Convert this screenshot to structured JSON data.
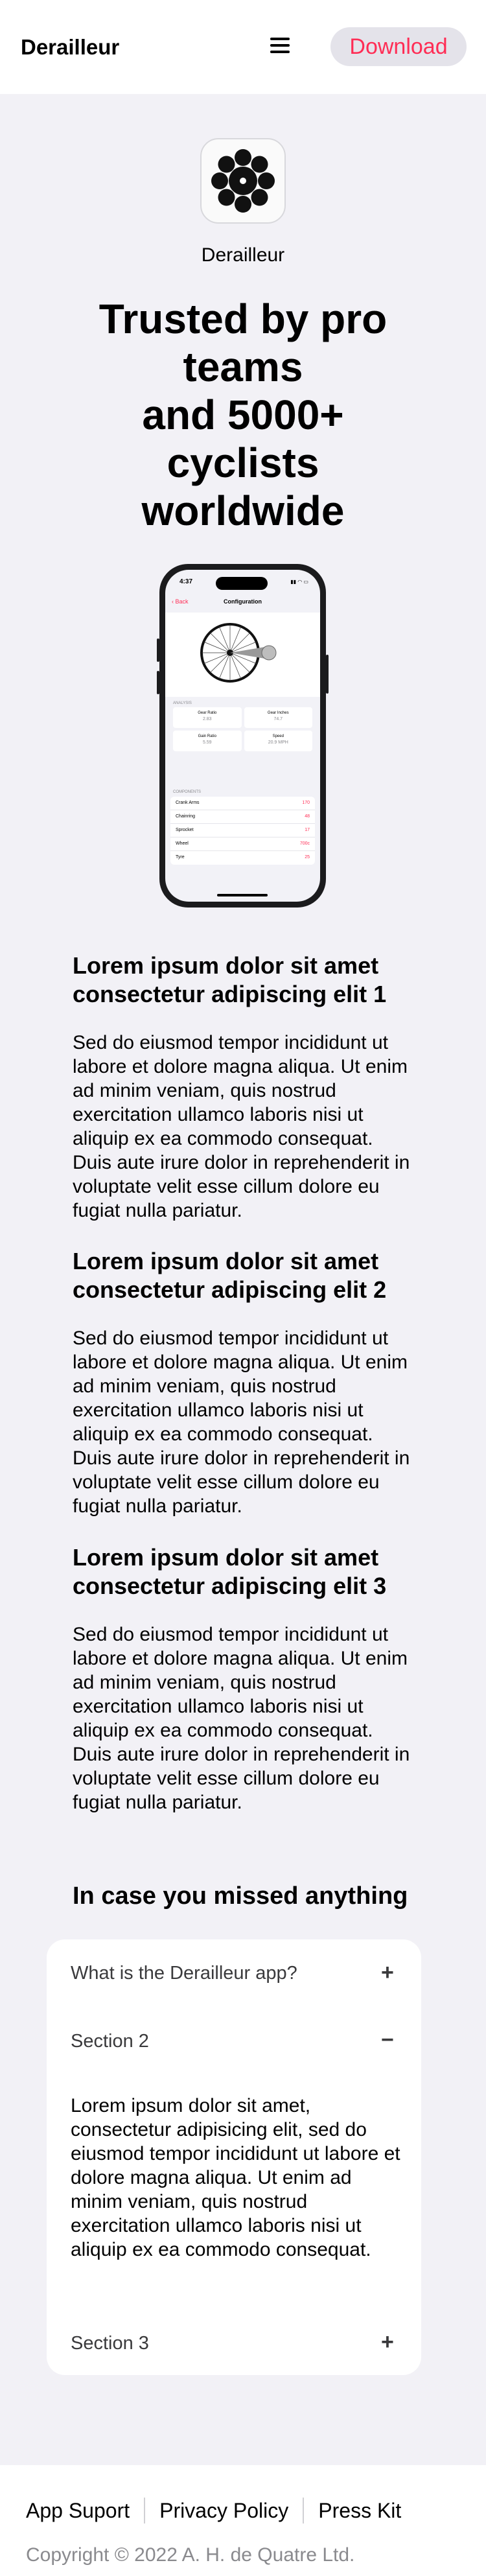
{
  "header": {
    "brand": "Derailleur",
    "menu_icon": "hamburger-menu-icon",
    "download_label": "Download"
  },
  "hero": {
    "app_icon": "derailleur-logo-icon",
    "app_name": "Derailleur",
    "headline_lines": [
      "Trusted by pro",
      "teams",
      "and 5000+",
      "cyclists",
      "worldwide"
    ]
  },
  "phone_mockup": {
    "time": "4:37",
    "back_label": "Back",
    "screen_title": "Configuration",
    "analysis_label": "ANALYSIS",
    "stats": [
      {
        "label": "Gear Ratio",
        "value": "2.83"
      },
      {
        "label": "Gear Inches",
        "value": "74.7"
      },
      {
        "label": "Gain Ratio",
        "value": "5.59"
      },
      {
        "label": "Speed",
        "value": "20.9 MPH"
      }
    ],
    "components_label": "COMPONENTS",
    "components": [
      {
        "label": "Crank Arms",
        "value": "170"
      },
      {
        "label": "Chainring",
        "value": "48"
      },
      {
        "label": "Sprocket",
        "value": "17"
      },
      {
        "label": "Wheel",
        "value": "700c"
      },
      {
        "label": "Tyre",
        "value": "25"
      }
    ]
  },
  "features": [
    {
      "title": "Lorem ipsum dolor sit amet consectetur adipiscing elit 1",
      "body": "Sed do eiusmod tempor incididunt ut labore et dolore magna aliqua. Ut enim ad minim veniam, quis nostrud exercitation ullamco laboris nisi ut aliquip ex ea commodo consequat. Duis aute irure dolor in reprehenderit in voluptate velit esse cillum dolore eu fugiat nulla pariatur."
    },
    {
      "title": "Lorem ipsum dolor sit amet consectetur adipiscing elit 2",
      "body": "Sed do eiusmod tempor incididunt ut labore et dolore magna aliqua. Ut enim ad minim veniam, quis nostrud exercitation ullamco laboris nisi ut aliquip ex ea commodo consequat. Duis aute irure dolor in reprehenderit in voluptate velit esse cillum dolore eu fugiat nulla pariatur."
    },
    {
      "title": "Lorem ipsum dolor sit amet consectetur adipiscing elit 3",
      "body": "Sed do eiusmod tempor incididunt ut labore et dolore magna aliqua. Ut enim ad minim veniam, quis nostrud exercitation ullamco laboris nisi ut aliquip ex ea commodo consequat. Duis aute irure dolor in reprehenderit in voluptate velit esse cillum dolore eu fugiat nulla pariatur."
    }
  ],
  "faq": {
    "heading": "In case you missed anything",
    "items": [
      {
        "question": "What is the Derailleur app?",
        "sign": "+",
        "expanded": false
      },
      {
        "question": "Section 2",
        "sign": "−",
        "expanded": true,
        "answer": "Lorem ipsum dolor sit amet, consectetur adipisicing elit, sed do eiusmod tempor incididunt ut labore et dolore magna aliqua. Ut enim ad minim veniam, quis nostrud exercitation ullamco laboris nisi ut aliquip ex ea commodo consequat."
      },
      {
        "question": "Section 3",
        "sign": "+",
        "expanded": false
      }
    ]
  },
  "footer": {
    "links": [
      "App Suport",
      "Privacy Policy",
      "Press Kit"
    ],
    "copyright": "Copyright © 2022 A. H. de Quatre Ltd."
  },
  "colors": {
    "accent": "#ff2d55",
    "page_background": "#f2f1f6",
    "surface": "#ffffff"
  }
}
